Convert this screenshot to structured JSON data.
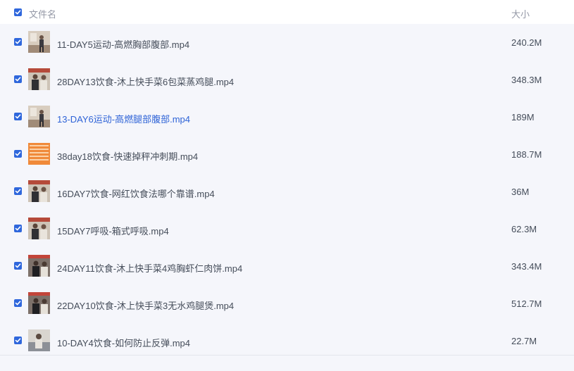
{
  "header": {
    "name_label": "文件名",
    "size_label": "大小",
    "select_all_checked": true
  },
  "accent_color": "#2f67dc",
  "link_color": "#2e63d7",
  "files": [
    {
      "name": "11-DAY5运动-高燃胸部腹部.mp4",
      "size": "240.2M",
      "checked": true,
      "thumb": "room"
    },
    {
      "name": "28DAY13饮食-沐上快手菜6包菜蒸鸡腿.mp4",
      "size": "348.3M",
      "checked": true,
      "thumb": "studio"
    },
    {
      "name": "13-DAY6运动-高燃腿部腹部.mp4",
      "size": "189M",
      "checked": true,
      "thumb": "room",
      "highlighted": true
    },
    {
      "name": "38day18饮食-快速掉秤冲刺期.mp4",
      "size": "188.7M",
      "checked": true,
      "thumb": "orange"
    },
    {
      "name": "16DAY7饮食-网红饮食法哪个靠谱.mp4",
      "size": "36M",
      "checked": true,
      "thumb": "studio"
    },
    {
      "name": "15DAY7呼吸-箱式呼吸.mp4",
      "size": "62.3M",
      "checked": true,
      "thumb": "studio"
    },
    {
      "name": "24DAY11饮食-沐上快手菜4鸡胸虾仁肉饼.mp4",
      "size": "343.4M",
      "checked": true,
      "thumb": "dark"
    },
    {
      "name": "22DAY10饮食-沐上快手菜3无水鸡腿煲.mp4",
      "size": "512.7M",
      "checked": true,
      "thumb": "dark"
    },
    {
      "name": "10-DAY4饮食-如何防止反弹.mp4",
      "size": "22.7M",
      "checked": true,
      "thumb": "grey"
    }
  ]
}
